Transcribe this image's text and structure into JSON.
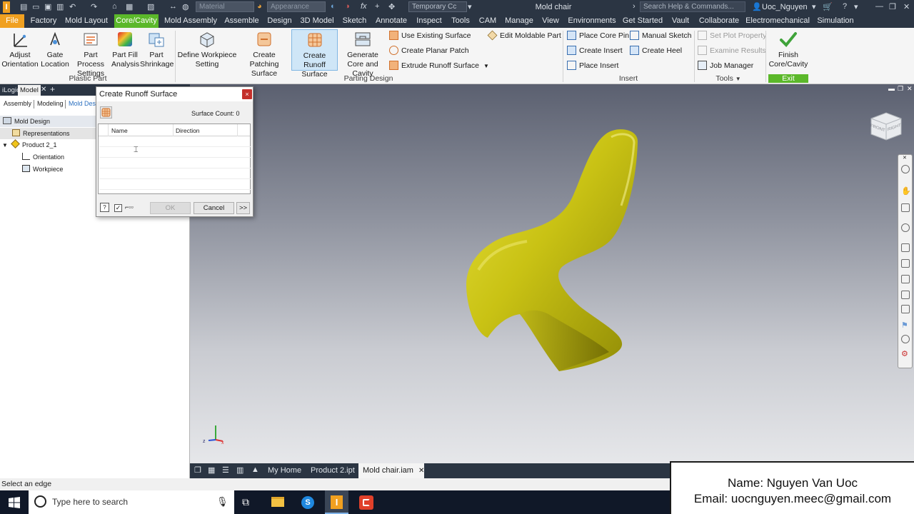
{
  "titlebar": {
    "window_title": "Mold chair",
    "material_placeholder": "Material",
    "appearance_placeholder": "Appearance",
    "view_rep": "Temporary Cc",
    "search_placeholder": "Search Help & Commands...",
    "user": "Uoc_Nguyen"
  },
  "menu": {
    "file": "File",
    "tabs": [
      "Factory",
      "Mold Layout",
      "Core/Cavity",
      "Mold Assembly",
      "Assemble",
      "Design",
      "3D Model",
      "Sketch",
      "Annotate",
      "Inspect",
      "Tools",
      "CAM",
      "Manage",
      "View",
      "Environments",
      "Get Started",
      "Vault",
      "Collaborate",
      "Electromechanical",
      "Simulation"
    ]
  },
  "ribbon": {
    "adjust_orientation": "Adjust Orientation",
    "gate_location": "Gate Location",
    "part_process_settings": "Part Process Settings",
    "part_fill_analysis": "Part Fill Analysis",
    "part_shrinkage": "Part Shrinkage",
    "group_plastic_part": "Plastic Part",
    "define_workpiece_setting": "Define Workpiece Setting",
    "create_patching_surface": "Create Patching Surface",
    "create_runoff_surface": "Create Runoff Surface",
    "generate_core_and_cavity": "Generate Core and Cavity",
    "use_existing_surface": "Use Existing Surface",
    "create_planar_patch": "Create Planar Patch",
    "extrude_runoff_surface": "Extrude Runoff Surface",
    "edit_moldable_part": "Edit Moldable Part",
    "group_parting_design": "Parting Design",
    "place_core_pin": "Place Core Pin",
    "manual_sketch": "Manual Sketch",
    "create_insert": "Create Insert",
    "create_heel": "Create Heel",
    "place_insert": "Place Insert",
    "group_insert": "Insert",
    "set_plot_property": "Set Plot Property",
    "examine_results": "Examine Results",
    "job_manager": "Job Manager",
    "group_tools": "Tools",
    "finish_core_cavity": "Finish Core/Cavity",
    "group_exit": "Exit"
  },
  "left_panel": {
    "tabs": [
      "iLogic",
      "Model"
    ],
    "add_tab": "+",
    "subtabs": [
      "Assembly",
      "Modeling",
      "Mold Desi"
    ],
    "tree": {
      "root": "Mold Design",
      "representations": "Representations",
      "product": "Product 2_1",
      "orientation": "Orientation",
      "workpiece": "Workpiece"
    }
  },
  "dialog": {
    "title": "Create Runoff Surface",
    "surface_count": "Surface Count: 0",
    "col_name": "Name",
    "col_direction": "Direction",
    "ok": "OK",
    "cancel": "Cancel",
    "more": ">>",
    "close": "×"
  },
  "viewcube": {
    "front": "FRONT",
    "right": "RIGHT"
  },
  "doc_tabs": [
    "My Home",
    "Product 2.ipt",
    "Mold chair.iam"
  ],
  "doc_tab_close": "✕",
  "status": "Select an edge",
  "taskbar": {
    "search_placeholder": "Type here to search"
  },
  "watermark": {
    "name": "Name: Nguyen Van Uoc",
    "email": "Email: uocnguyen.meec@gmail.com"
  },
  "colors": {
    "accent_green": "#5bb82a",
    "file_orange": "#f0a020",
    "chair_yellow": "#c9c214",
    "dark_chrome": "#2b3543"
  }
}
